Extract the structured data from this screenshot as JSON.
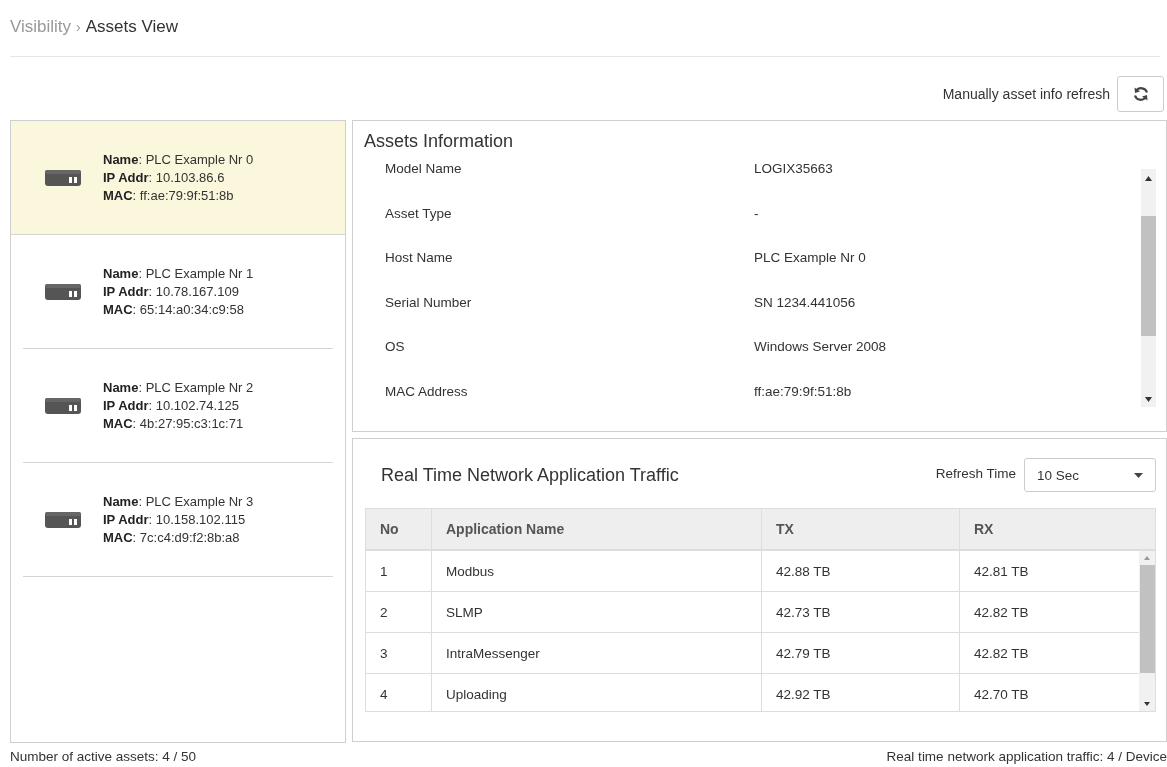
{
  "breadcrumb": {
    "items": [
      {
        "label": "Visibility",
        "current": false
      },
      {
        "label": "Assets View",
        "current": true
      }
    ],
    "separator": "›"
  },
  "refresh": {
    "label": "Manually asset info refresh"
  },
  "assets": [
    {
      "selected": true,
      "lines": [
        "**Name**: PLC Example Nr 0",
        "**IP Addr**: 10.103.86.6",
        "**MAC**: ff:ae:79:9f:51:8b"
      ]
    },
    {
      "selected": false,
      "lines": [
        "**Name**: PLC Example Nr 1",
        "**IP Addr**: 10.78.167.109",
        "**MAC**: 65:14:a0:34:c9:58"
      ]
    },
    {
      "selected": false,
      "lines": [
        "**Name**: PLC Example Nr 2",
        "**IP Addr**: 10.102.74.125",
        "**MAC**: 4b:27:95:c3:1c:71"
      ]
    },
    {
      "selected": false,
      "lines": [
        "**Name**: PLC Example Nr 3",
        "**IP Addr**: 10.158.102.115",
        "**MAC**: 7c:c4:d9:f2:8b:a8"
      ]
    }
  ],
  "assets_information": {
    "title": "Assets Information",
    "rows": [
      {
        "label": "Model Name",
        "value": "LOGIX35663"
      },
      {
        "label": "Asset Type",
        "value": "-"
      },
      {
        "label": "Host Name",
        "value": "PLC Example Nr 0"
      },
      {
        "label": "Serial Number",
        "value": "SN 1234.441056"
      },
      {
        "label": "OS",
        "value": "Windows Server 2008"
      },
      {
        "label": "MAC Address",
        "value": "ff:ae:79:9f:51:8b"
      }
    ]
  },
  "traffic": {
    "title": "Real Time Network Application Traffic",
    "refresh_time": {
      "label": "Refresh Time",
      "value": "10 Sec"
    },
    "columns": [
      "No",
      "Application Name",
      "TX",
      "RX"
    ],
    "rows": [
      [
        "1",
        "Modbus",
        "42.88 TB",
        "42.81 TB"
      ],
      [
        "2",
        "SLMP",
        "42.73 TB",
        "42.82 TB"
      ],
      [
        "3",
        "IntraMessenger",
        "42.79 TB",
        "42.82 TB"
      ],
      [
        "4",
        "Uploading",
        "42.92 TB",
        "42.70 TB"
      ]
    ]
  },
  "status_bar": {
    "left": "Number of active assets: 4 / 50",
    "right": "Real time network application traffic: 4 / Device"
  }
}
